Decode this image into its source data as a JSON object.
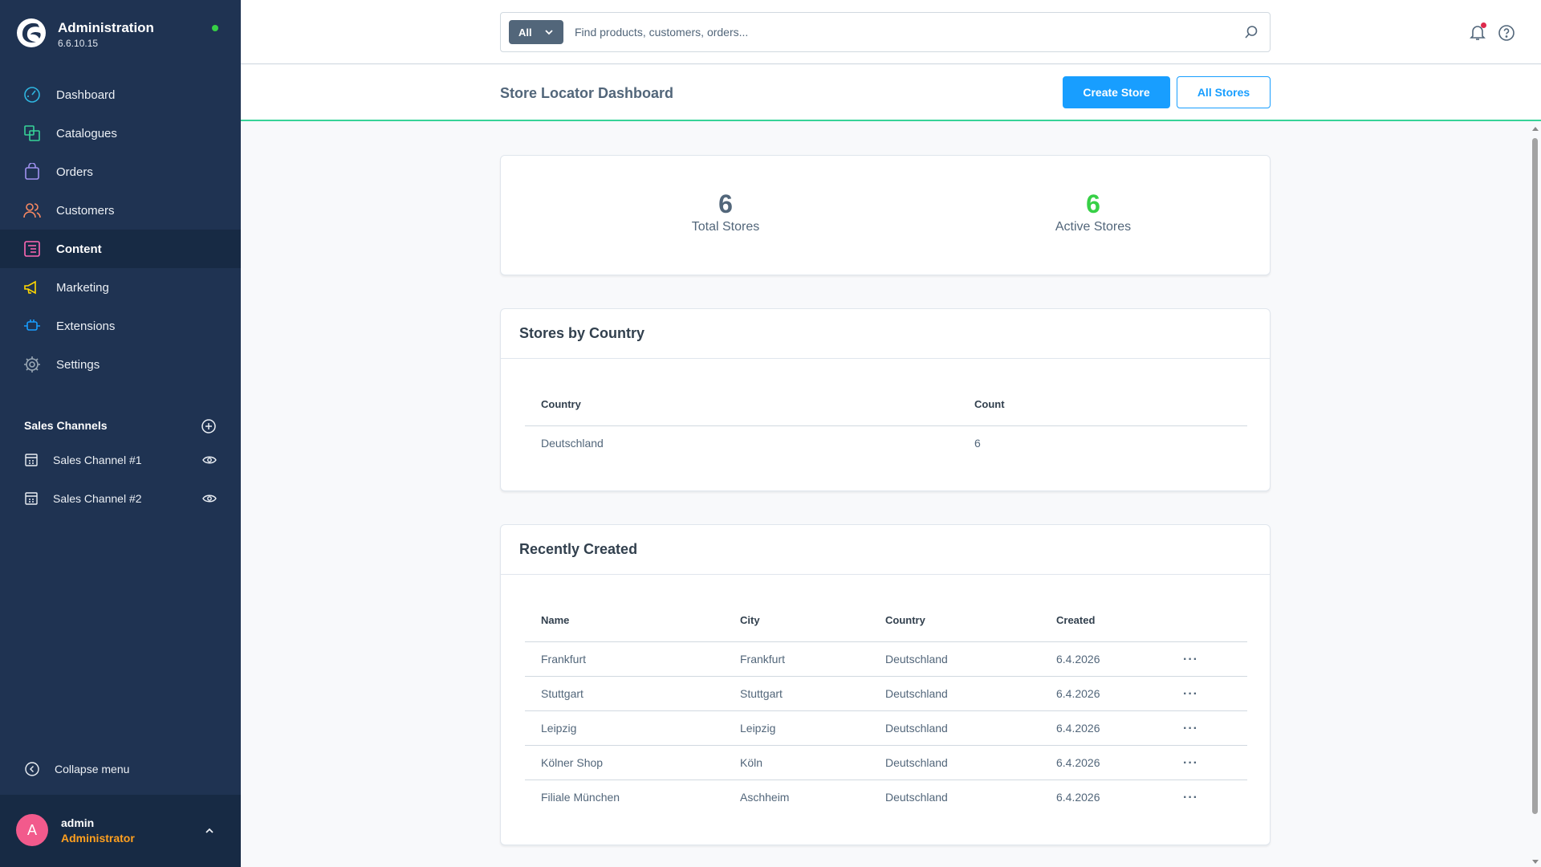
{
  "brand": {
    "title": "Administration",
    "version": "6.6.10.15"
  },
  "nav": [
    {
      "label": "Dashboard",
      "icon": "dashboard-icon",
      "color": "#2fb6e0"
    },
    {
      "label": "Catalogues",
      "icon": "catalogues-icon",
      "color": "#37d398"
    },
    {
      "label": "Orders",
      "icon": "orders-icon",
      "color": "#a092f0"
    },
    {
      "label": "Customers",
      "icon": "customers-icon",
      "color": "#f88962"
    },
    {
      "label": "Content",
      "icon": "content-icon",
      "color": "#ff68b4",
      "active": true
    },
    {
      "label": "Marketing",
      "icon": "marketing-icon",
      "color": "#ffd700"
    },
    {
      "label": "Extensions",
      "icon": "extensions-icon",
      "color": "#189eff"
    },
    {
      "label": "Settings",
      "icon": "settings-icon",
      "color": "#9aa8b5"
    }
  ],
  "sales_channels": {
    "title": "Sales Channels",
    "items": [
      {
        "label": "Sales Channel #1"
      },
      {
        "label": "Sales Channel #2"
      }
    ]
  },
  "collapse_label": "Collapse menu",
  "user": {
    "initial": "A",
    "name": "admin",
    "role": "Administrator"
  },
  "search": {
    "type": "All",
    "placeholder": "Find products, customers, orders..."
  },
  "page": {
    "title": "Store Locator Dashboard",
    "create_label": "Create Store",
    "all_label": "All Stores"
  },
  "stats": {
    "total": {
      "value": "6",
      "label": "Total Stores"
    },
    "active": {
      "value": "6",
      "label": "Active Stores"
    }
  },
  "by_country": {
    "title": "Stores by Country",
    "headers": {
      "country": "Country",
      "count": "Count"
    },
    "rows": [
      {
        "country": "Deutschland",
        "count": "6"
      }
    ]
  },
  "recent": {
    "title": "Recently Created",
    "headers": {
      "name": "Name",
      "city": "City",
      "country": "Country",
      "created": "Created"
    },
    "rows": [
      {
        "name": "Frankfurt",
        "city": "Frankfurt",
        "country": "Deutschland",
        "created": "6.4.2026"
      },
      {
        "name": "Stuttgart",
        "city": "Stuttgart",
        "country": "Deutschland",
        "created": "6.4.2026"
      },
      {
        "name": "Leipzig",
        "city": "Leipzig",
        "country": "Deutschland",
        "created": "6.4.2026"
      },
      {
        "name": "Kölner Shop",
        "city": "Köln",
        "country": "Deutschland",
        "created": "6.4.2026"
      },
      {
        "name": "Filiale München",
        "city": "Aschheim",
        "country": "Deutschland",
        "created": "6.4.2026"
      }
    ]
  },
  "colors": {
    "sidebar": "#1f3352",
    "primary": "#189eff",
    "success": "#37d046",
    "accent_line": "#37d398"
  }
}
